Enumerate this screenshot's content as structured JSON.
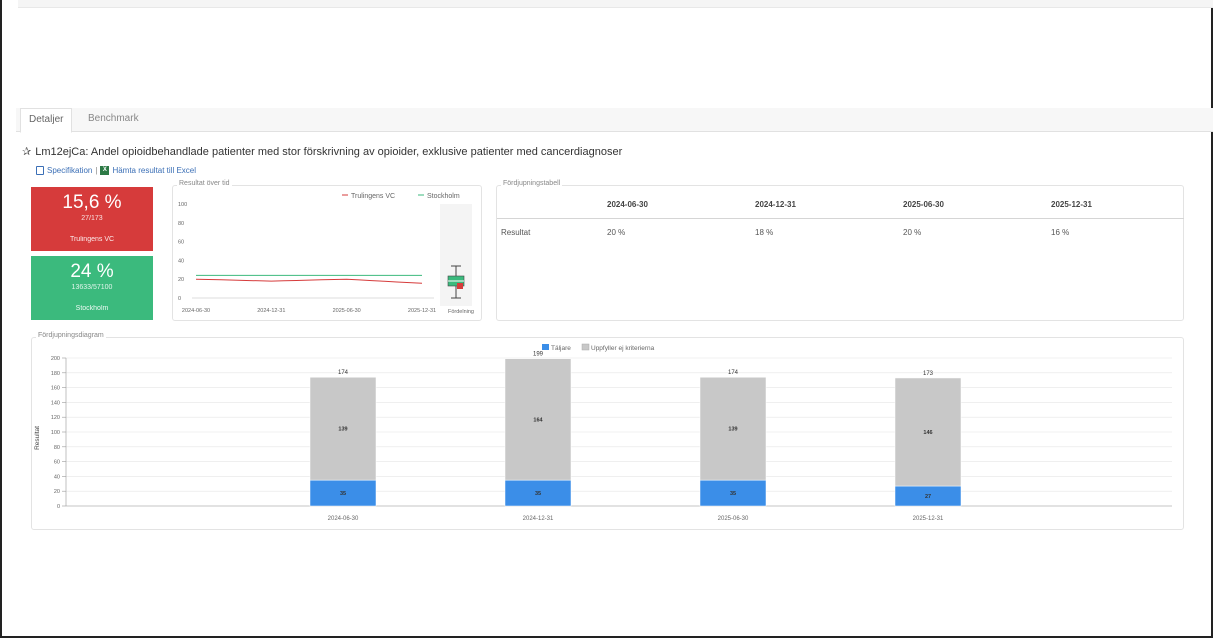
{
  "tabs": [
    {
      "label": "Detaljer",
      "active": true
    },
    {
      "label": "Benchmark",
      "active": false
    }
  ],
  "title": "Lm12ejCa: Andel opioidbehandlade patienter med stor förskrivning av opioider, exklusive patienter med cancerdiagnoser",
  "links": {
    "specification": "Specifikation",
    "excel": "Hämta resultat till Excel"
  },
  "kpis": [
    {
      "value": "15,6 %",
      "sub": "27/173",
      "name": "Trulingens VC",
      "color": "#d63b3b"
    },
    {
      "value": "24 %",
      "sub": "13633/57100",
      "name": "Stockholm",
      "color": "#3bba7d"
    }
  ],
  "trend": {
    "title": "Resultat över tid",
    "legend": [
      "Trulingens VC",
      "Stockholm"
    ],
    "yticks": [
      "100",
      "80",
      "60",
      "40",
      "20",
      "0"
    ],
    "xticks": [
      "2024-06-30",
      "2024-12-31",
      "2025-06-30",
      "2025-12-31"
    ],
    "extra_label": "Fördelning",
    "chart_data": {
      "type": "line",
      "x": [
        "2024-06-30",
        "2024-12-31",
        "2025-06-30",
        "2025-12-31"
      ],
      "ylim": [
        0,
        100
      ],
      "series": [
        {
          "name": "Trulingens VC",
          "color": "#d63b3b",
          "values": [
            20,
            18,
            20,
            15.6
          ]
        },
        {
          "name": "Stockholm",
          "color": "#3bba7d",
          "values": [
            24,
            24,
            24,
            24
          ]
        }
      ]
    }
  },
  "table": {
    "title": "Fördjupningstabell",
    "columns": [
      "",
      "2024-06-30",
      "2024-12-31",
      "2025-06-30",
      "2025-12-31"
    ],
    "rows": [
      {
        "label": "Resultat",
        "values": [
          "20 %",
          "18 %",
          "20 %",
          "16 %"
        ]
      }
    ]
  },
  "bars": {
    "title": "Fördjupningsdiagram",
    "legend": [
      "Täljare",
      "Uppfyller ej kriterierna"
    ],
    "ylabel": "Resultat",
    "yticks": [
      "0",
      "20",
      "40",
      "60",
      "80",
      "100",
      "120",
      "140",
      "160",
      "180",
      "200"
    ],
    "chart_data": {
      "type": "bar",
      "stacked": true,
      "categories": [
        "2024-06-30",
        "2024-12-31",
        "2025-06-30",
        "2025-12-31"
      ],
      "ylim": [
        0,
        200
      ],
      "ylabel": "Resultat",
      "totals": [
        174,
        199,
        174,
        173
      ],
      "series": [
        {
          "name": "Täljare",
          "color": "#3b8ee8",
          "values": [
            35,
            35,
            35,
            27
          ]
        },
        {
          "name": "Uppfyller ej kriterierna",
          "color": "#c8c8c8",
          "values": [
            139,
            164,
            139,
            146
          ]
        }
      ]
    }
  }
}
